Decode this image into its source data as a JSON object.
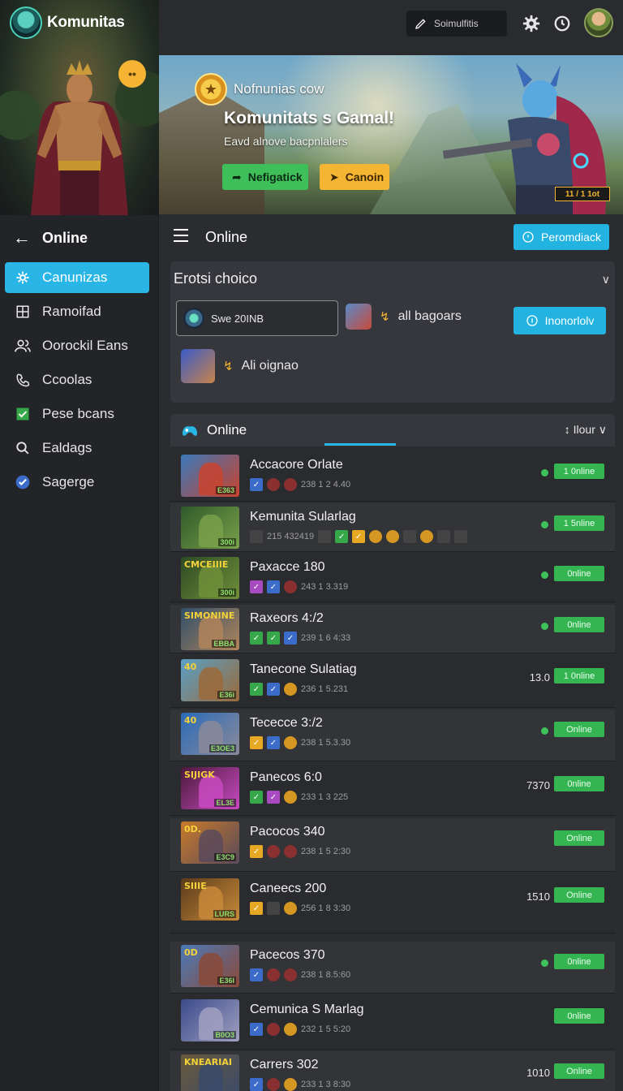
{
  "brand": {
    "title": "Komunitas",
    "chat_icon": "chat-bubble-icon"
  },
  "sidebar": {
    "back_label": "Online",
    "items": [
      {
        "label": "Canunizas",
        "icon": "gear-icon",
        "active": true
      },
      {
        "label": "Ramoifad",
        "icon": "grid-icon",
        "active": false
      },
      {
        "label": "Oorockil Eans",
        "icon": "users-icon",
        "active": false
      },
      {
        "label": "Ccoolas",
        "icon": "phone-icon",
        "active": false
      },
      {
        "label": "Pese bcans",
        "icon": "check-box-icon",
        "active": false
      },
      {
        "label": "Ealdags",
        "icon": "search-icon",
        "active": false
      },
      {
        "label": "Sagerge",
        "icon": "verified-icon",
        "active": false
      }
    ]
  },
  "topbar": {
    "search_label": "Soimulfitis"
  },
  "banner": {
    "kicker": "Nofnunias cow",
    "title": "Komunitats s Gamal!",
    "subtitle": "Eavd alnove bacpnlalers",
    "btn_primary": "Nefigatick",
    "btn_secondary": "Canoin",
    "tag": "11 / 1 1ot"
  },
  "section": {
    "title": "Online",
    "button": "Peromdiack"
  },
  "filter": {
    "title": "Erotsi choico",
    "select_value": "Swe 20INB",
    "option1": "all bagoars",
    "option2": "Ali oignao",
    "button": "Inonorlolv"
  },
  "list": {
    "title": "Online",
    "sort_label": "Ilour"
  },
  "rows": [
    {
      "name": "Accacore Orlate",
      "meta": "238 1 2 4.40",
      "count": "",
      "status": "1 0nline",
      "thumb_top": "",
      "thumb_bot": "E363",
      "colors": [
        "#3a78b8",
        "#c8432f"
      ]
    },
    {
      "name": "Kemunita Sularlag",
      "meta": "215 432419",
      "count": "",
      "status": "1 5nline",
      "thumb_top": "",
      "thumb_bot": "300i",
      "colors": [
        "#2f5a2a",
        "#79a04a"
      ]
    },
    {
      "name": "Paxacce 180",
      "meta": "243 1 3.319",
      "count": "",
      "status": "0nline",
      "thumb_top": "CMCEIIIE",
      "thumb_bot": "300i",
      "colors": [
        "#2e4a24",
        "#6f8f3a"
      ]
    },
    {
      "name": "Raxeors 4:/2",
      "meta": "239 1 6 4:33",
      "count": "",
      "status": "0nline",
      "thumb_top": "SIMONINE",
      "thumb_bot": "EBBA",
      "colors": [
        "#2f4f6a",
        "#b0845a"
      ]
    },
    {
      "name": "Tanecone Sulatiag",
      "meta": "236 1 5.231",
      "count": "13.0",
      "status": "1 0nline",
      "thumb_top": "40",
      "thumb_bot": "E36i",
      "colors": [
        "#5aa0c8",
        "#9a6a3a"
      ]
    },
    {
      "name": "Tececce 3:/2",
      "meta": "238 1 5.3.30",
      "count": "",
      "status": "Online",
      "thumb_top": "40",
      "thumb_bot": "E3OE3",
      "colors": [
        "#2a6ab8",
        "#8a8a9a"
      ]
    },
    {
      "name": "Panecos 6:0",
      "meta": "233 1 3 225",
      "count": "7370",
      "status": "0nline",
      "thumb_top": "SIJIGK",
      "thumb_bot": "EL3E",
      "colors": [
        "#4a1a3a",
        "#c84ac0"
      ]
    },
    {
      "name": "Pacocos 340",
      "meta": "238 1 5 2:30",
      "count": "",
      "status": "Online",
      "thumb_top": "0D.",
      "thumb_bot": "E3C9",
      "colors": [
        "#c87a2a",
        "#5a4a5a"
      ]
    },
    {
      "name": "Caneecs 200",
      "meta": "256 1 8 3:30",
      "count": "1510",
      "status": "Online",
      "thumb_top": "SIIIE",
      "thumb_bot": "LURS",
      "colors": [
        "#5a3a1a",
        "#c88a3a"
      ]
    },
    {
      "name": "Pacecos 370",
      "meta": "238 1 8.5:60",
      "count": "",
      "status": "0nline",
      "thumb_top": "0D",
      "thumb_bot": "E36I",
      "colors": [
        "#4a7ab8",
        "#8a4a3a"
      ]
    },
    {
      "name": "Cemunica S Marlag",
      "meta": "232 1 5 5:20",
      "count": "",
      "status": "0nline",
      "thumb_top": "",
      "thumb_bot": "B0O3",
      "colors": [
        "#3a4a8a",
        "#a0a0c0"
      ]
    },
    {
      "name": "Carrers 302",
      "meta": "233 1 3 8:30",
      "count": "1010",
      "status": "Online",
      "thumb_top": "KNEARIAI",
      "thumb_bot": "",
      "colors": [
        "#6a5a3a",
        "#3a4a6a"
      ]
    }
  ],
  "colors": {
    "accent": "#29b6e6",
    "online": "#35b552",
    "warning": "#f4b632"
  }
}
